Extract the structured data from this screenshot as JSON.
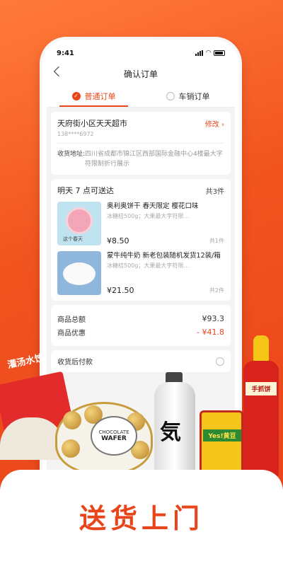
{
  "status_bar": {
    "time": "9:41"
  },
  "nav": {
    "title": "确认订单"
  },
  "tabs": [
    {
      "label": "普通订单",
      "active": true
    },
    {
      "label": "车销订单",
      "active": false
    }
  ],
  "shop": {
    "name": "天府街小区天天超市",
    "edit_label": "修改 ›",
    "phone": "138****6972",
    "address_label": "收货地址:",
    "address": "四川省成都市锦江区西部国际金融中心4楼最大字符限制折行展示"
  },
  "delivery": {
    "title": "明天 7 点可送达",
    "total_count": "共3件"
  },
  "items": [
    {
      "name": "奥利奥饼干 春天限定 樱花口味",
      "spec": "冰糖桔500g；大果最大字符限...",
      "price": "¥8.50",
      "qty": "共1件",
      "thumb_text": "这个春天"
    },
    {
      "name": "蒙牛纯牛奶 新老包装随机发货12装/箱",
      "spec": "冰糖桔500g；大果最大字符限...",
      "price": "¥21.50",
      "qty": "共2件"
    }
  ],
  "summary": {
    "total_label": "商品总额",
    "total": "¥93.3",
    "discount_label": "商品优惠",
    "discount": "- ¥41.8"
  },
  "payment": {
    "label": "收货后付款"
  },
  "products": {
    "bag": "灌汤水饺",
    "wafer_line1": "CHOCOLATE",
    "wafer_line2": "WAFER",
    "bottle": "気",
    "jar": "Yes!黄豆",
    "sauce": "手抓饼"
  },
  "slogan": "送货上门",
  "colors": {
    "accent": "#e8451b",
    "background_top": "#f2541f"
  }
}
